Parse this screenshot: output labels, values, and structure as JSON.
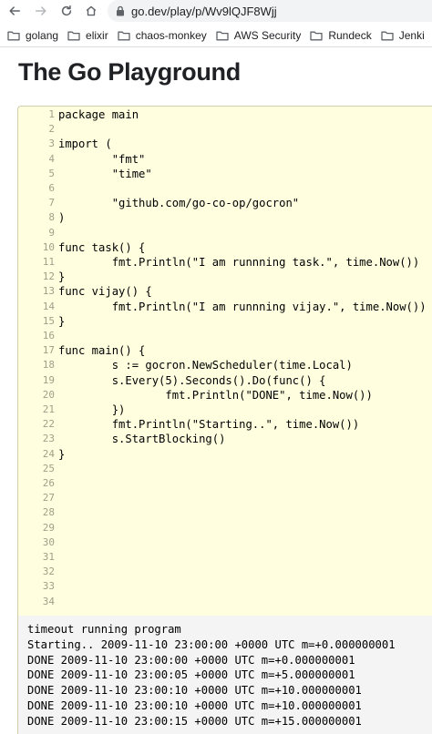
{
  "browser": {
    "url": "go.dev/play/p/Wv9lQJF8Wjj",
    "bookmarks": [
      "golang",
      "elixir",
      "chaos-monkey",
      "AWS Security",
      "Rundeck",
      "Jenki"
    ]
  },
  "page": {
    "title": "The Go Playground"
  },
  "editor": {
    "lines": [
      {
        "n": "1",
        "code": "package main"
      },
      {
        "n": "2",
        "code": ""
      },
      {
        "n": "3",
        "code": "import ("
      },
      {
        "n": "4",
        "code": "        \"fmt\""
      },
      {
        "n": "5",
        "code": "        \"time\""
      },
      {
        "n": "6",
        "code": ""
      },
      {
        "n": "7",
        "code": "        \"github.com/go-co-op/gocron\""
      },
      {
        "n": "8",
        "code": ")"
      },
      {
        "n": "9",
        "code": ""
      },
      {
        "n": "10",
        "code": "func task() {"
      },
      {
        "n": "11",
        "code": "        fmt.Println(\"I am runnning task.\", time.Now())"
      },
      {
        "n": "12",
        "code": "}"
      },
      {
        "n": "13",
        "code": "func vijay() {"
      },
      {
        "n": "14",
        "code": "        fmt.Println(\"I am runnning vijay.\", time.Now())"
      },
      {
        "n": "15",
        "code": "}"
      },
      {
        "n": "16",
        "code": ""
      },
      {
        "n": "17",
        "code": "func main() {"
      },
      {
        "n": "18",
        "code": "        s := gocron.NewScheduler(time.Local)"
      },
      {
        "n": "19",
        "code": "        s.Every(5).Seconds().Do(func() {"
      },
      {
        "n": "20",
        "code": "                fmt.Println(\"DONE\", time.Now())"
      },
      {
        "n": "21",
        "code": "        })"
      },
      {
        "n": "22",
        "code": "        fmt.Println(\"Starting..\", time.Now())"
      },
      {
        "n": "23",
        "code": "        s.StartBlocking()"
      },
      {
        "n": "24",
        "code": "}"
      },
      {
        "n": "25",
        "code": ""
      },
      {
        "n": "26",
        "code": ""
      },
      {
        "n": "27",
        "code": ""
      },
      {
        "n": "28",
        "code": ""
      },
      {
        "n": "29",
        "code": ""
      },
      {
        "n": "30",
        "code": ""
      },
      {
        "n": "31",
        "code": ""
      },
      {
        "n": "32",
        "code": ""
      },
      {
        "n": "33",
        "code": ""
      },
      {
        "n": "34",
        "code": ""
      }
    ]
  },
  "output": {
    "lines": [
      "timeout running program",
      "Starting.. 2009-11-10 23:00:00 +0000 UTC m=+0.000000001",
      "DONE 2009-11-10 23:00:00 +0000 UTC m=+0.000000001",
      "DONE 2009-11-10 23:00:05 +0000 UTC m=+5.000000001",
      "DONE 2009-11-10 23:00:10 +0000 UTC m=+10.000000001",
      "DONE 2009-11-10 23:00:10 +0000 UTC m=+10.000000001",
      "DONE 2009-11-10 23:00:15 +0000 UTC m=+15.000000001"
    ]
  }
}
